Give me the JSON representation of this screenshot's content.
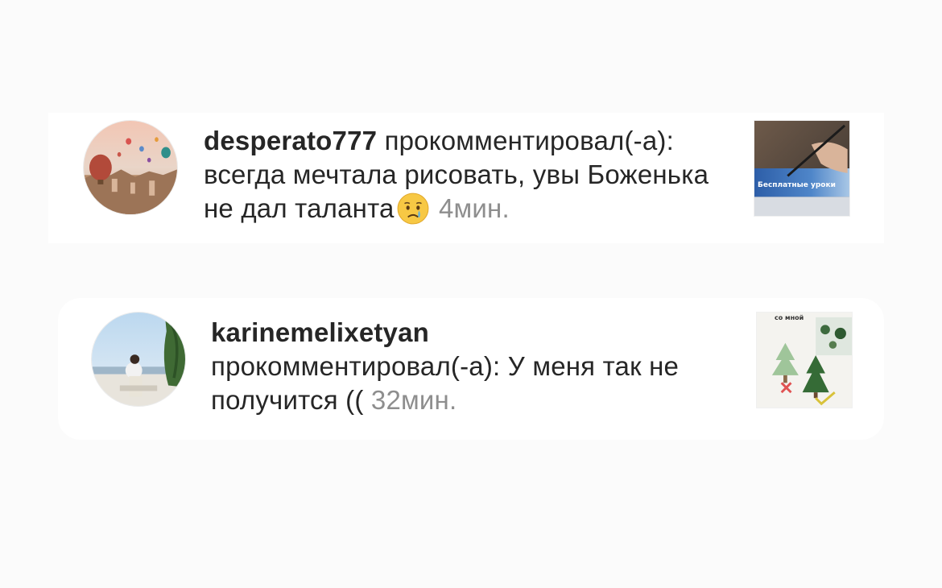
{
  "notifications": [
    {
      "username": "desperato777",
      "action": "прокомментировал(-а):",
      "comment": "всегда мечтала рисовать, увы Боженька не дал таланта",
      "emoji": "crying-face",
      "time": "4мин.",
      "thumbnail_caption": "Бесплатные уроки"
    },
    {
      "username": "karinemelixetyan",
      "action": "прокомментировал(-а):",
      "comment": "У меня так не получится ((",
      "time": "32мин.",
      "thumbnail_caption": "со мной"
    }
  ],
  "colors": {
    "background": "#fbfbfb",
    "card": "#ffffff",
    "text": "#262626",
    "timestamp": "#8e8e8e"
  }
}
